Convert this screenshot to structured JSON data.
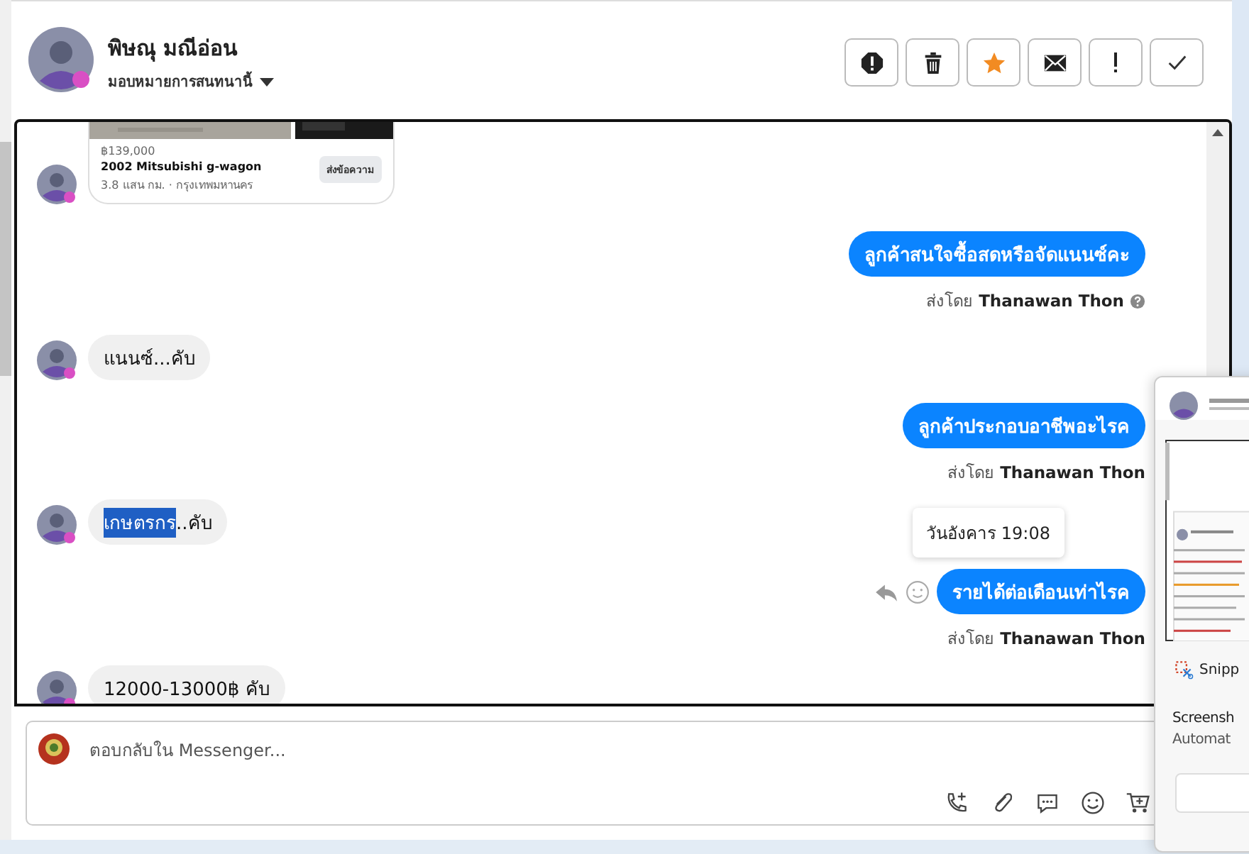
{
  "contact": {
    "name": "พิษณุ มณีอ่อน",
    "assign_label": "มอบหมายการสนทนานี้"
  },
  "toolbar": [
    {
      "kind": "alert"
    },
    {
      "kind": "trash"
    },
    {
      "kind": "star"
    },
    {
      "kind": "mail"
    },
    {
      "kind": "exclaim"
    },
    {
      "kind": "check"
    }
  ],
  "messages": [
    {
      "kind": "product",
      "price": "฿139,000",
      "title": "2002 Mitsubishi g-wagon",
      "meta": "3.8 แสน กม. · กรุงเทพมหานคร",
      "button": "ส่งข้อความ"
    },
    {
      "kind": "outgoing",
      "text": "ลูกค้าสนใจซื้อสดหรือจัดแนนซ์คะ",
      "sender_prefix": "ส่งโดย",
      "sender": "Thanawan Thon",
      "info_icon": true,
      "hover_actions": false
    },
    {
      "kind": "incoming",
      "text": "แนนซ์...คับ"
    },
    {
      "kind": "outgoing",
      "text": "ลูกค้าประกอบอาชีพอะไรค",
      "sender_prefix": "ส่งโดย",
      "sender": "Thanawan Thon",
      "info_icon": false,
      "hover_actions": false
    },
    {
      "kind": "incoming",
      "selected_text": "เกษตรกร",
      "text": "..คับ"
    },
    {
      "kind": "outgoing",
      "text": "รายได้ต่อเดือนเท่าไรค",
      "sender_prefix": "ส่งโดย",
      "sender": "Thanawan Thon",
      "info_icon": false,
      "tooltip": "วันอังคาร 19:08",
      "hover_actions": true
    },
    {
      "kind": "incoming",
      "text": "12000-13000฿ คับ"
    }
  ],
  "composer": {
    "placeholder": "ตอบกลับใน Messenger..."
  },
  "notification": {
    "app": "Snipp",
    "title": "Screensh",
    "body": "Automat"
  }
}
